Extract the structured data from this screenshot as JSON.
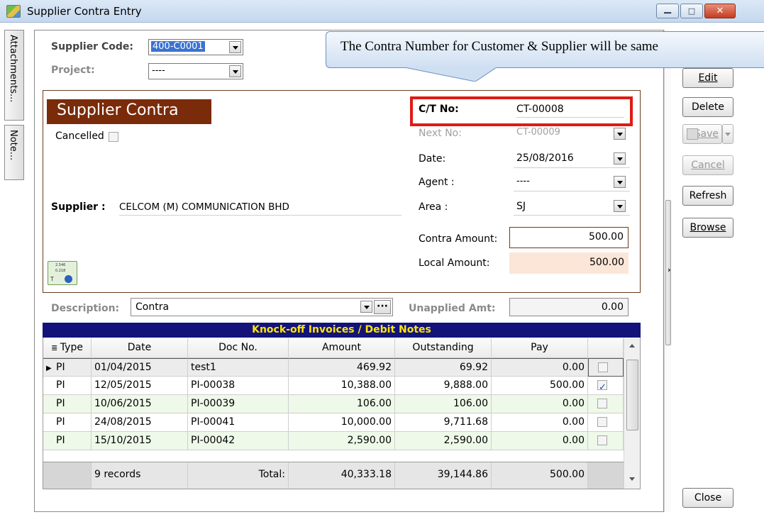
{
  "window": {
    "title": "Supplier Contra Entry",
    "min_glyph": "▁",
    "max_glyph": "□",
    "close_glyph": "✕"
  },
  "side_tabs": {
    "attachments": "Attachments...",
    "note": "Note..."
  },
  "header": {
    "supplier_code_label": "Supplier Code:",
    "supplier_code_value": "400-C0001",
    "project_label": "Project:",
    "project_value": "----"
  },
  "callout": {
    "text": "The Contra Number for Customer & Supplier will be same"
  },
  "form": {
    "title": "Supplier Contra",
    "cancelled_label": "Cancelled",
    "supplier_label": "Supplier :",
    "supplier_value": "CELCOM (M) COMMUNICATION BHD",
    "ct_no_label": "C/T No:",
    "ct_no_value": "CT-00008",
    "next_no_label": "Next No:",
    "next_no_value": "CT-00009",
    "date_label": "Date:",
    "date_value": "25/08/2016",
    "agent_label": "Agent :",
    "agent_value": "----",
    "area_label": "Area :",
    "area_value": "SJ",
    "contra_amount_label": "Contra Amount:",
    "contra_amount_value": "500.00",
    "local_amount_label": "Local Amount:",
    "local_amount_value": "500.00",
    "description_label": "Description:",
    "description_value": "Contra",
    "description_more": "···",
    "unapplied_label": "Unapplied Amt:",
    "unapplied_value": "0.00",
    "calc_icon_text_1": "2.546",
    "calc_icon_text_2": "0.218",
    "calc_icon_text_3": "T"
  },
  "toolbar": {
    "edit": "Edit",
    "delete": "Delete",
    "save": "Save",
    "cancel": "Cancel",
    "refresh": "Refresh",
    "browse": "Browse",
    "close": "Close"
  },
  "grid": {
    "title": "Knock-off Invoices / Debit Notes",
    "columns": [
      "Type",
      "Date",
      "Doc No.",
      "Amount",
      "Outstanding",
      "Pay"
    ],
    "rows": [
      {
        "type": "PI",
        "date": "01/04/2015",
        "doc": "test1",
        "amount": "469.92",
        "outstanding": "69.92",
        "pay": "0.00",
        "checked": false
      },
      {
        "type": "PI",
        "date": "12/05/2015",
        "doc": "PI-00038",
        "amount": "10,388.00",
        "outstanding": "9,888.00",
        "pay": "500.00",
        "checked": true
      },
      {
        "type": "PI",
        "date": "10/06/2015",
        "doc": "PI-00039",
        "amount": "106.00",
        "outstanding": "106.00",
        "pay": "0.00",
        "checked": false
      },
      {
        "type": "PI",
        "date": "24/08/2015",
        "doc": "PI-00041",
        "amount": "10,000.00",
        "outstanding": "9,711.68",
        "pay": "0.00",
        "checked": false
      },
      {
        "type": "PI",
        "date": "15/10/2015",
        "doc": "PI-00042",
        "amount": "2,590.00",
        "outstanding": "2,590.00",
        "pay": "0.00",
        "checked": false
      }
    ],
    "footer": {
      "records": "9 records",
      "total_label": "Total:",
      "total_amount": "40,333.18",
      "total_outstanding": "39,144.86",
      "total_pay": "500.00"
    }
  },
  "colors": {
    "title_banner": "#7a2b0a",
    "grid_title_bg": "#13137a",
    "grid_title_fg": "#ffe600",
    "highlight_border": "#e01b14",
    "local_amount_bg": "#fbe6d7"
  }
}
